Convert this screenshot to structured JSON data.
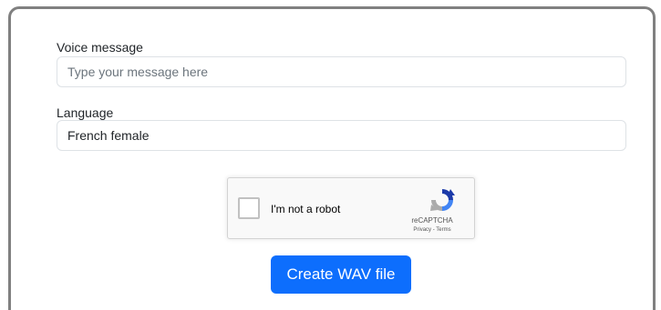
{
  "form": {
    "message_label": "Voice message",
    "message_placeholder": "Type your message here",
    "message_value": "",
    "language_label": "Language",
    "language_selected": "French female",
    "submit_label": "Create WAV file"
  },
  "recaptcha": {
    "label": "I'm not a robot",
    "brand": "reCAPTCHA",
    "links": "Privacy - Terms",
    "logo_icon": "recaptcha-logo-icon"
  },
  "colors": {
    "primary": "#0d6efd",
    "border": "#dee2e6",
    "frame": "#808080"
  }
}
